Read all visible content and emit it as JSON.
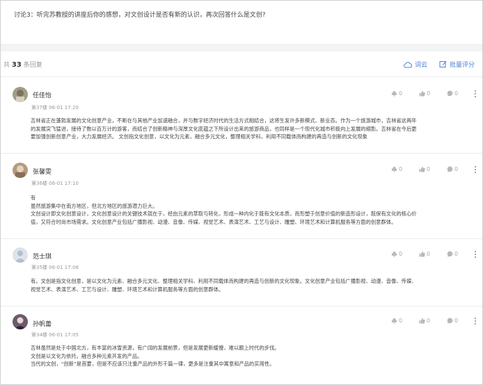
{
  "discussion": {
    "topic": "讨论3：听完苏教授的讲座后你的感想，对文创设计是否有新的认识，再次回答什么是文创?"
  },
  "header": {
    "count_prefix": "共",
    "count": "33",
    "count_suffix": "条回复",
    "word_cloud": "词云",
    "batch_score": "批量评分"
  },
  "replies": [
    {
      "name": "任佳怡",
      "floor": "第37楼",
      "time": "06-01 17:20",
      "likes": "0",
      "thumbs": "0",
      "comments": "0",
      "lines": [
        "吉林省正在蓬勃发展的文化创意产业，不断在与其他产业加速融合，并与数字经济时代的生活方式相结合，这将生发许多新模式、新业态。作为一个旅游城市，吉林省这两年",
        "的发展突飞猛进，接待了数以百万计的游客，而结合了创新精神与深厚文化底蕴之下所设计出来的旅游商品，也同样是一个现代化城市积极向上发展的缩影。吉林省在今后更",
        "要加强创新创意产业，大力发展经济。 文创指文化创意，以文化为元素，融合多元文化，整理相关学科，利用不同载体而构建的再造与创新的文化现象"
      ]
    },
    {
      "name": "张馨雯",
      "floor": "第36楼",
      "time": "06-01 17:10",
      "likes": "0",
      "thumbs": "0",
      "comments": "0",
      "lines": [
        "有",
        "虽然旅游集中在南方地区，但北方地区的旅游潜力巨大。",
        "文创设计即文化创意设计，文化创意设计的关键技术就在于，经由元素的萃取与转化，形成一种内化于既有文化本质，而形塑于创意价值的新造形设计，既保有文化的核心价",
        "值，又符合时尚市场需求。文化创意产业包括广播影视、动漫、音像、传媒、视觉艺术、表演艺术、工艺与设计、雕塑、环境艺术和计算机服务等方面的创意群体。"
      ]
    },
    {
      "name": "范士琪",
      "floor": "第35楼",
      "time": "06-01 17:08",
      "likes": "0",
      "thumbs": "0",
      "comments": "0",
      "lines": [
        "有。文创是指文化创意，是以文化为元素、融合多元文化、整理相关学科、利用不同载体而构建的再造与创新的文化现象。文化创意产业包括广播影视、动漫、音像、传媒、",
        "视觉艺术、表演艺术、工艺与设计、雕塑、环境艺术和计算机服务等方面的创意群体。"
      ]
    },
    {
      "name": "孙帆蕾",
      "floor": "第34楼",
      "time": "06-01 17:05",
      "likes": "0",
      "thumbs": "0",
      "comments": "0",
      "lines": [
        "吉林虽然是处于中国北方，有丰富的冰雪资源，有广阔的发展前景，但是发展更新缓慢，难以跟上时代的步伐。",
        "文创是以文化为依托，融合多种元素开发的产品。",
        "当代的文创，“创新”是首要，但是不应该只注重产品的外形千篇一律，更多是注重其中寓意和产品的实用性。"
      ]
    }
  ]
}
